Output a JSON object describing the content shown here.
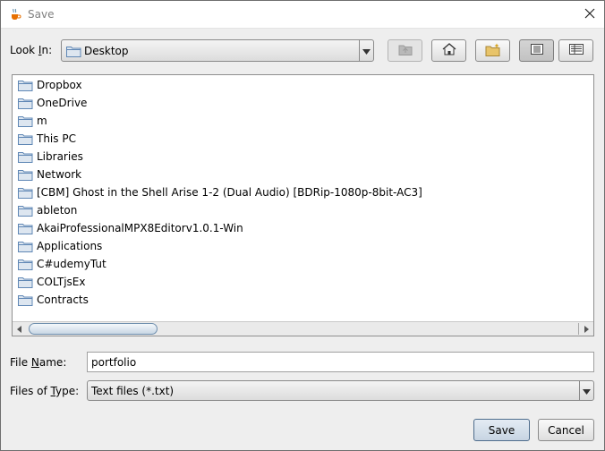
{
  "window": {
    "title": "Save",
    "icon": "java-cup-icon",
    "close_icon": "close-icon"
  },
  "look_in": {
    "label_pre": "Look ",
    "label_mnemonic": "I",
    "label_post": "n:",
    "value": "Desktop"
  },
  "toolbar": [
    {
      "name": "up-one-level-button",
      "icon": "up-folder-icon",
      "enabled": false,
      "selected": false
    },
    {
      "name": "home-button",
      "icon": "home-icon",
      "enabled": true,
      "selected": false
    },
    {
      "name": "new-folder-button",
      "icon": "new-folder-icon",
      "enabled": true,
      "selected": false
    },
    {
      "name": "list-view-button",
      "icon": "list-view-icon",
      "enabled": true,
      "selected": true
    },
    {
      "name": "details-view-button",
      "icon": "details-view-icon",
      "enabled": true,
      "selected": false
    }
  ],
  "files": [
    "Dropbox",
    "OneDrive",
    "m",
    "This PC",
    "Libraries",
    "Network",
    "[CBM] Ghost in the Shell Arise 1-2 (Dual Audio) [BDRip-1080p-8bit-AC3]",
    "ableton",
    "AkaiProfessionalMPX8Editorv1.0.1-Win",
    "Applications",
    "C#udemyTut",
    "COLTjsEx",
    "Contracts"
  ],
  "file_name": {
    "label_pre": "File ",
    "label_mnemonic": "N",
    "label_post": "ame:",
    "value": "portfolio"
  },
  "file_type": {
    "label_pre": "Files of ",
    "label_mnemonic": "T",
    "label_post": "ype:",
    "value": "Text files (*.txt)"
  },
  "buttons": {
    "save": "Save",
    "cancel": "Cancel"
  },
  "colors": {
    "folder": "#5f87b5",
    "accent": "#4e6c8c",
    "background": "#eeeeee"
  }
}
